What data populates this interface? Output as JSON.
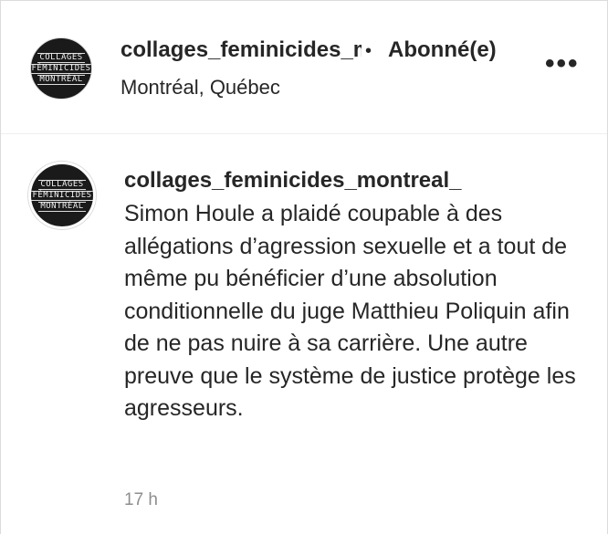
{
  "header": {
    "username": "collages_feminicides_montreal_",
    "separator": "•",
    "follow_label": "Abonné(e)",
    "location": "Montréal, Québec",
    "more_glyph": "•••"
  },
  "avatar_logo": [
    "COLLAGES",
    "FÉMINICIDES",
    "MONTRÉAL"
  ],
  "caption": {
    "username": "collages_feminicides_montreal_",
    "text": "Simon Houle a plaidé coupable à des allégations d’agression sexuelle et a tout de même pu bénéficier d’une absolution conditionnelle du juge Matthieu Poliquin afin de ne pas nuire à sa carrière. Une autre preuve que le système de justice protège les agresseurs.",
    "timestamp": "17 h"
  }
}
